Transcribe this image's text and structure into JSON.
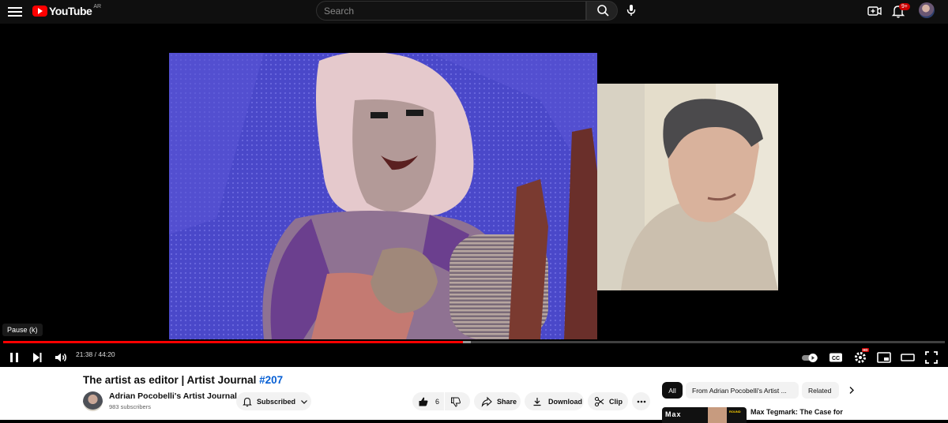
{
  "header": {
    "logo_text": "YouTube",
    "region": "AR",
    "search_placeholder": "Search",
    "notifications_badge": "9+"
  },
  "player": {
    "tooltip": "Pause (k)",
    "time_current": "21:38",
    "time_separator": " / ",
    "time_total": "44:20",
    "played_fraction": 0.488,
    "buffered_fraction": 0.497,
    "hd_badge": "HD"
  },
  "video": {
    "title": "The artist as editor | Artist Journal ",
    "hashtag": "#207",
    "channel_name": "Adrian Pocobelli's Artist Journal",
    "subscribers": "983 subscribers",
    "subscribed_label": "Subscribed",
    "likes": "6",
    "share_label": "Share",
    "download_label": "Download",
    "clip_label": "Clip"
  },
  "sidebar": {
    "chips": [
      "All",
      "From Adrian Pocobelli's Artist ...",
      "Related"
    ],
    "recommendation_title": "Max Tegmark: The Case for",
    "thumb_text": "Max",
    "thumb_round": "ROUND"
  },
  "colors": {
    "brand_red": "#ff0000",
    "link_blue": "#065fd4",
    "player_bg": "#000000"
  }
}
